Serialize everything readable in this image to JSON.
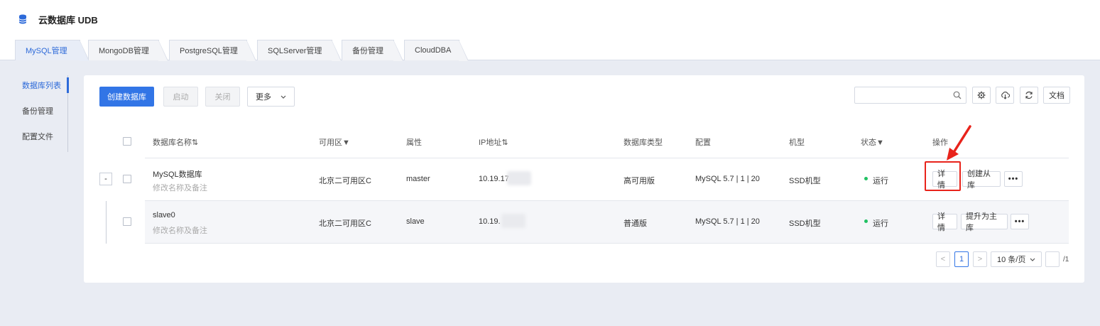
{
  "app": {
    "title": "云数据库 UDB",
    "logo_icon": "database-icon"
  },
  "tabs": [
    {
      "label": "MySQL管理",
      "active": true
    },
    {
      "label": "MongoDB管理"
    },
    {
      "label": "PostgreSQL管理"
    },
    {
      "label": "SQLServer管理"
    },
    {
      "label": "备份管理"
    },
    {
      "label": "CloudDBA"
    }
  ],
  "sidebar": {
    "items": [
      {
        "label": "数据库列表",
        "active": true
      },
      {
        "label": "备份管理"
      },
      {
        "label": "配置文件"
      }
    ]
  },
  "toolbar": {
    "create_label": "创建数据库",
    "start_label": "启动",
    "stop_label": "关闭",
    "more_label": "更多",
    "search_placeholder": "",
    "docs_label": "文档"
  },
  "table": {
    "headers": {
      "name": "数据库名称⇅",
      "zone": "可用区▼",
      "attr": "属性",
      "ip": "IP地址⇅",
      "db_type": "数据库类型",
      "config": "配置",
      "machine": "机型",
      "status": "状态▼",
      "ops": "操作"
    },
    "rows": [
      {
        "name": "MySQL数据库",
        "remark": "修改名称及备注",
        "zone": "北京二可用区C",
        "attr": "master",
        "ip": "10.19.17",
        "db_type": "高可用版",
        "config": "MySQL 5.7 | 1 | 20",
        "machine": "SSD机型",
        "status": "运行",
        "op1": "详情",
        "op2": "创建从库",
        "op3": "•••"
      },
      {
        "name": "slave0",
        "remark": "修改名称及备注",
        "zone": "北京二可用区C",
        "attr": "slave",
        "ip": "10.19.",
        "db_type": "普通版",
        "config": "MySQL 5.7 | 1 | 20",
        "machine": "SSD机型",
        "status": "运行",
        "op1": "详情",
        "op2": "提升为主库",
        "op3": "•••"
      }
    ],
    "expand_symbol": "-"
  },
  "pagination": {
    "prev": "<",
    "current_page": "1",
    "next": ">",
    "page_size": "10 条/页",
    "total_pages": "/1"
  },
  "colors": {
    "accent": "#3275e6",
    "status_running": "#21c163",
    "highlight": "#e8231b"
  }
}
